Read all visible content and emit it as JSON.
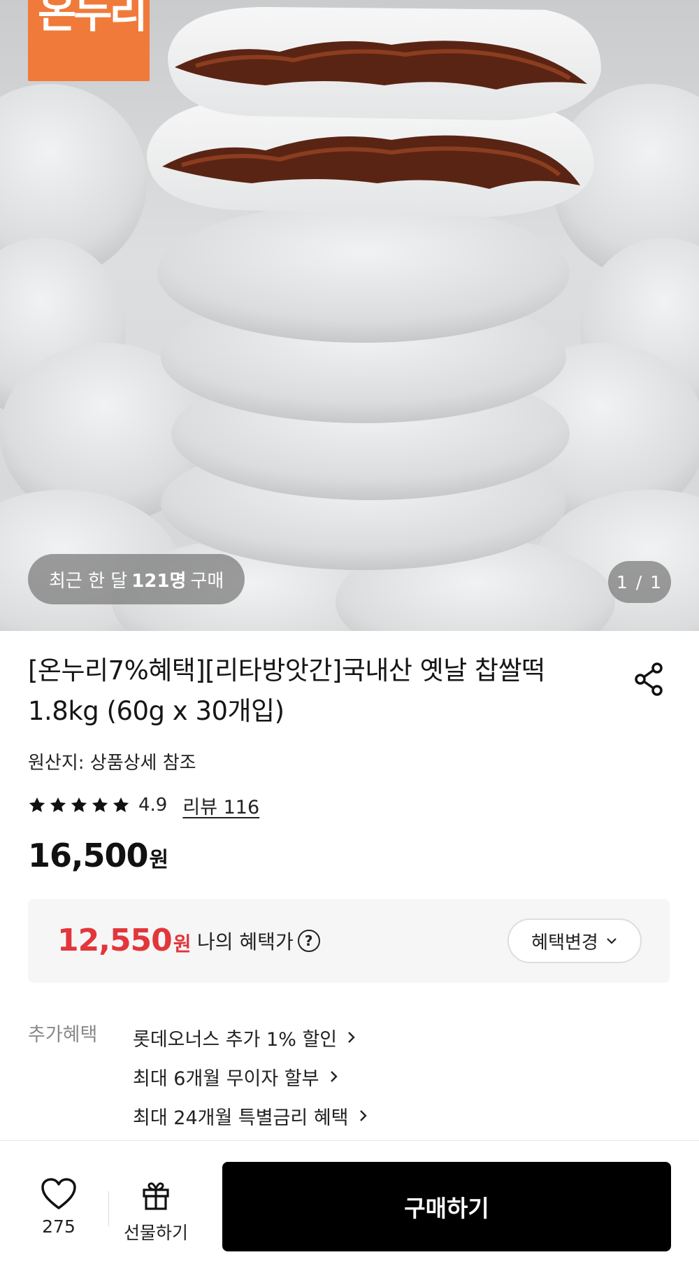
{
  "hero": {
    "image_alt": "rice cakes with red bean filling",
    "brand_logo_text": "온누리",
    "recent_buyers_prefix": "최근 한 달",
    "recent_buyers_count": "121명",
    "recent_buyers_suffix": "구매",
    "page_indicator": "1 / 1",
    "brand_color": "#f07a3a"
  },
  "product": {
    "title_line1": "[온누리7%혜택][리타방앗간]국내산 옛날 찹쌀떡",
    "title_line2": "1.8kg (60g x 30개입)",
    "origin": "원산지: 상품상세 참조",
    "rating": "4.9",
    "stars_filled": 5,
    "review_link": "리뷰 116",
    "price": "16,500",
    "price_unit": "원",
    "share_icon": "share-icon"
  },
  "benefit": {
    "price": "12,550",
    "price_unit": "원",
    "label": "나의 혜택가",
    "help_icon_text": "?",
    "change_button": "혜택변경",
    "accent_color": "#e2363b"
  },
  "extra_benefits": {
    "label": "추가혜택",
    "items": [
      "롯데오너스 추가 1% 할인",
      "최대 6개월 무이자 할부",
      "최대 24개월 특별금리 혜택"
    ]
  },
  "bottom_bar": {
    "wish_count": "275",
    "gift_label": "선물하기",
    "buy_label": "구매하기"
  }
}
